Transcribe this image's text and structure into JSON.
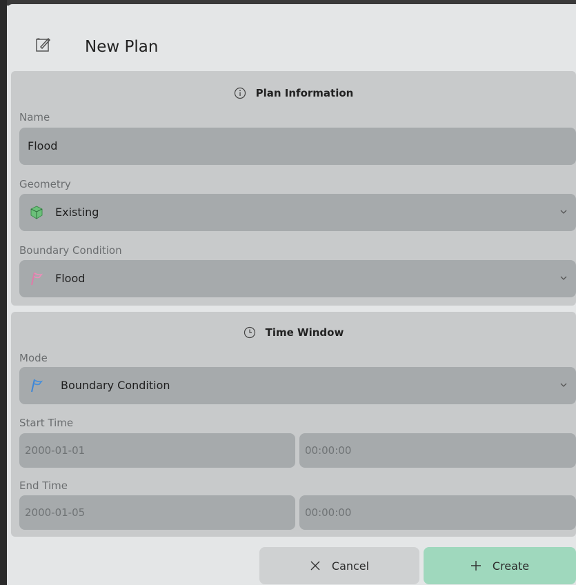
{
  "dialog": {
    "title": "New Plan",
    "title_icon": "edit-plan-icon"
  },
  "plan_info": {
    "header": "Plan Information",
    "header_icon": "info-icon",
    "name": {
      "label": "Name",
      "value": "Flood"
    },
    "geometry": {
      "label": "Geometry",
      "value": "Existing",
      "icon": "cube-icon"
    },
    "boundary": {
      "label": "Boundary Condition",
      "value": "Flood",
      "icon": "flag-icon"
    }
  },
  "time_window": {
    "header": "Time Window",
    "header_icon": "clock-icon",
    "mode": {
      "label": "Mode",
      "value": "Boundary Condition",
      "icon": "flag-icon"
    },
    "start": {
      "label": "Start Time",
      "date": "2000-01-01",
      "time": "00:00:00"
    },
    "end": {
      "label": "End Time",
      "date": "2000-01-05",
      "time": "00:00:00"
    }
  },
  "actions": {
    "cancel": "Cancel",
    "create": "Create"
  },
  "colors": {
    "create_accent": "#9fd8bd",
    "geometry_icon": "#5fbf6f",
    "boundary_icon_pink": "#e88fb8",
    "mode_icon_blue": "#4a90d9"
  }
}
